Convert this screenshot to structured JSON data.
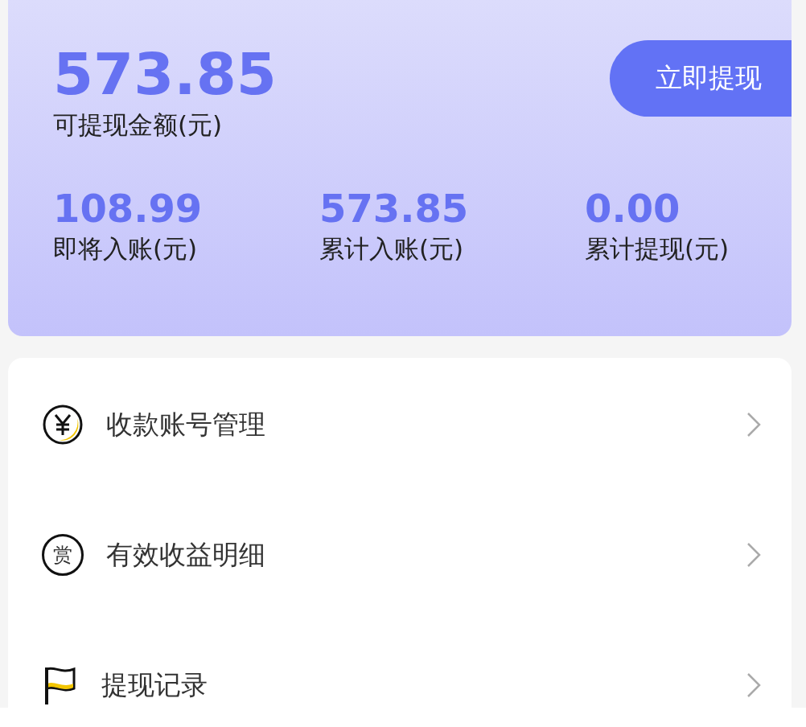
{
  "balance": {
    "amount": "573.85",
    "label": "可提现金额(元)",
    "withdraw_button": "立即提现"
  },
  "stats": [
    {
      "value": "108.99",
      "label": "即将入账(元)"
    },
    {
      "value": "573.85",
      "label": "累计入账(元)"
    },
    {
      "value": "0.00",
      "label": "累计提现(元)"
    }
  ],
  "menu": [
    {
      "kind": "yen",
      "label": "收款账号管理"
    },
    {
      "kind": "reward",
      "icon_char": "赏",
      "label": "有效收益明细"
    },
    {
      "kind": "flag",
      "label": "提现记录"
    }
  ]
}
